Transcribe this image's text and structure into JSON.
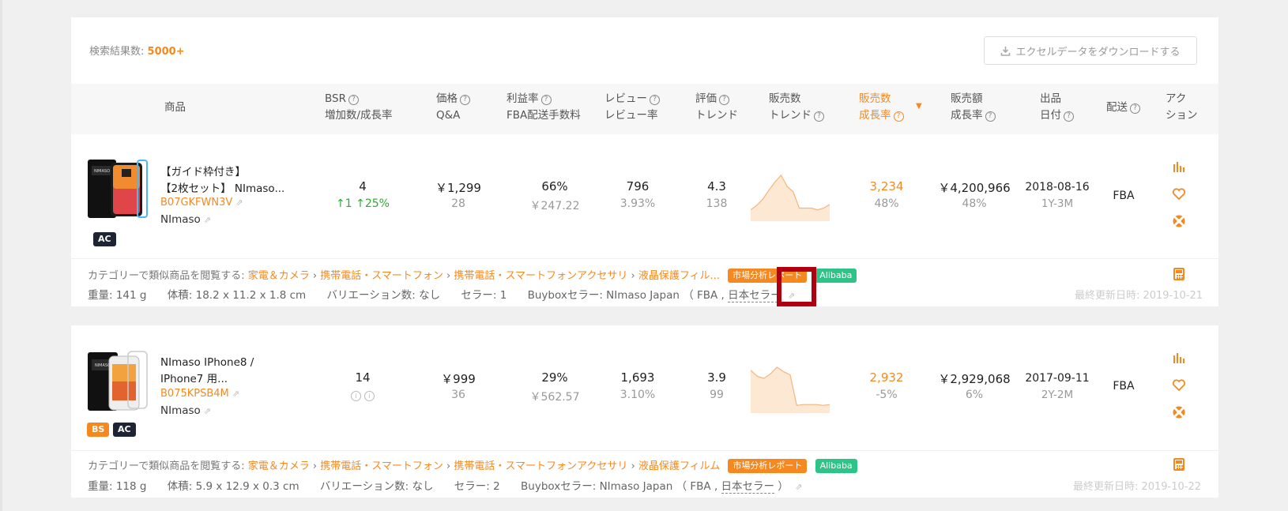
{
  "header": {
    "result_label": "検索結果数:",
    "result_count": "5000+",
    "download_label": "エクセルデータをダウンロードする"
  },
  "columns": {
    "product": "商品",
    "bsr_1": "BSR",
    "bsr_2": "増加数/成長率",
    "price_1": "価格",
    "price_2": "Q&A",
    "margin_1": "利益率",
    "margin_2": "FBA配送手数料",
    "review_1": "レビュー",
    "review_2": "レビュー率",
    "rating_1": "評価",
    "rating_2": "トレンド",
    "sales_trend_1": "販売数",
    "sales_trend_2": "トレンド",
    "sales_growth_1": "販売数",
    "sales_growth_2": "成長率",
    "revenue_1": "販売額",
    "revenue_2": "成長率",
    "listed_1": "出品",
    "listed_2": "日付",
    "shipping": "配送",
    "action_1": "アク",
    "action_2": "ション"
  },
  "products": [
    {
      "title_line1": "【ガイド枠付き】",
      "title_line2": "【2枚セット】 NImaso...",
      "asin": "B07GKFWN3V",
      "brand": "NImaso",
      "badges": [
        "AC"
      ],
      "bsr": "4",
      "bsr_change": "↑1 ↑25%",
      "price": "￥1,299",
      "qa": "28",
      "margin": "66%",
      "fba_fee": "￥247.22",
      "reviews": "796",
      "review_rate": "3.93%",
      "rating": "4.3",
      "rating_trend": "138",
      "sales": "3,234",
      "sales_growth": "48%",
      "revenue": "￥4,200,966",
      "revenue_growth": "48%",
      "listed_date": "2018-08-16",
      "listed_age": "1Y-3M",
      "shipping": "FBA",
      "category_prefix": "カテゴリーで類似商品を閲覧する:",
      "crumbs": [
        "家電＆カメラ",
        "携帯電話・スマートフォン",
        "携帯電話・スマートフォンアクセサリ",
        "液晶保護フィル..."
      ],
      "market_tag": "市場分析レポート",
      "alibaba_tag": "Alibaba",
      "weight": "重量: 141 g",
      "size": "体積: 18.2 x 11.2 x 1.8 cm",
      "variations": "バリエーション数: なし",
      "sellers": "セラー: 1",
      "buybox_prefix": "Buyboxセラー:  NImaso Japan （ FBA ,",
      "buybox_origin": "日本セラー",
      "buybox_suffix": "",
      "updated": "最終更新日時: 2019-10-21",
      "spark": [
        0.18,
        0.28,
        0.42,
        0.62,
        0.8,
        0.95,
        0.7,
        0.58,
        0.22,
        0.22,
        0.22,
        0.18,
        0.22,
        0.3
      ]
    },
    {
      "title_line1": "NImaso IPhone8 /",
      "title_line2": "IPhone7 用...",
      "asin": "B075KPSB4M",
      "brand": "NImaso",
      "badges": [
        "BS",
        "AC"
      ],
      "bsr": "14",
      "bsr_change": "",
      "price": "￥999",
      "qa": "36",
      "margin": "29%",
      "fba_fee": "￥562.57",
      "reviews": "1,693",
      "review_rate": "3.10%",
      "rating": "3.9",
      "rating_trend": "99",
      "sales": "2,932",
      "sales_growth": "-5%",
      "revenue": "￥2,929,068",
      "revenue_growth": "6%",
      "listed_date": "2017-09-11",
      "listed_age": "2Y-2M",
      "shipping": "FBA",
      "category_prefix": "カテゴリーで類似商品を閲覧する:",
      "crumbs": [
        "家電＆カメラ",
        "携帯電話・スマートフォン",
        "携帯電話・スマートフォンアクセサリ",
        "液晶保護フィルム"
      ],
      "market_tag": "市場分析レポート",
      "alibaba_tag": "Alibaba",
      "weight": "重量: 118 g",
      "size": "体積: 5.9 x 12.9 x 0.3 cm",
      "variations": "バリエーション数: なし",
      "sellers": "セラー: 2",
      "buybox_prefix": "Buyboxセラー:  NImaso Japan （ FBA ,",
      "buybox_origin": "日本セラー",
      "buybox_suffix": "）",
      "updated": "最終更新日時: 2019-10-22",
      "spark": [
        0.88,
        0.75,
        0.7,
        0.8,
        0.95,
        0.85,
        0.78,
        0.1,
        0.12,
        0.12,
        0.12,
        0.1,
        0.12
      ]
    }
  ],
  "colors": {
    "accent": "#f5891f",
    "alibaba": "#2ec487",
    "badge_dark": "#1e2433",
    "highlight": "#b0000f",
    "up": "#2fa835"
  },
  "icons": [
    "download-icon",
    "question-icon",
    "external-link-icon",
    "bar-chart-icon",
    "heart-icon",
    "lifebuoy-icon",
    "calculator-icon",
    "info-icon",
    "sort-caret-icon"
  ]
}
